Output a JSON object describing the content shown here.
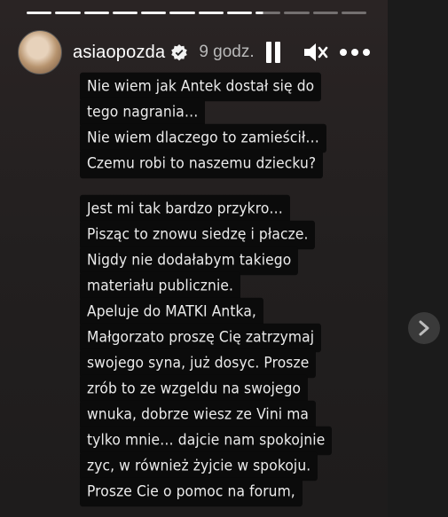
{
  "story": {
    "progress_total": 12,
    "progress_done": 8,
    "progress_active_fraction": 0.3,
    "username": "asiaopozda",
    "time": "9 godz.",
    "icons": {
      "verified": "verified-badge-icon",
      "pause": "pause-icon",
      "mute": "speaker-muted-icon",
      "more": "more-options-icon",
      "next": "chevron-right-icon"
    },
    "text_lines": [
      "Nie wiem jak Antek dostał się do",
      "tego nagrania…",
      "Nie wiem dlaczego to zamieścił…",
      "Czemu robi to naszemu dziecku?",
      "",
      "Jest mi tak bardzo przykro…",
      "Pisząc to znowu siedzę i płacze.",
      "Nigdy nie dodałabym takiego",
      "materiału publicznie.",
      "Apeluje do MATKI Antka,",
      "Małgorzato proszę Cię zatrzymaj",
      "swojego syna, już dosyc. Prosze",
      "zrób to ze wzgeldu na swojego",
      "wnuka, dobrze wiesz ze Vini ma",
      "tylko mnie…  dajcie nam spokojnie",
      "zyc, w również żyjcie w spokoju.",
      "Prosze Cie o pomoc na forum,"
    ]
  }
}
